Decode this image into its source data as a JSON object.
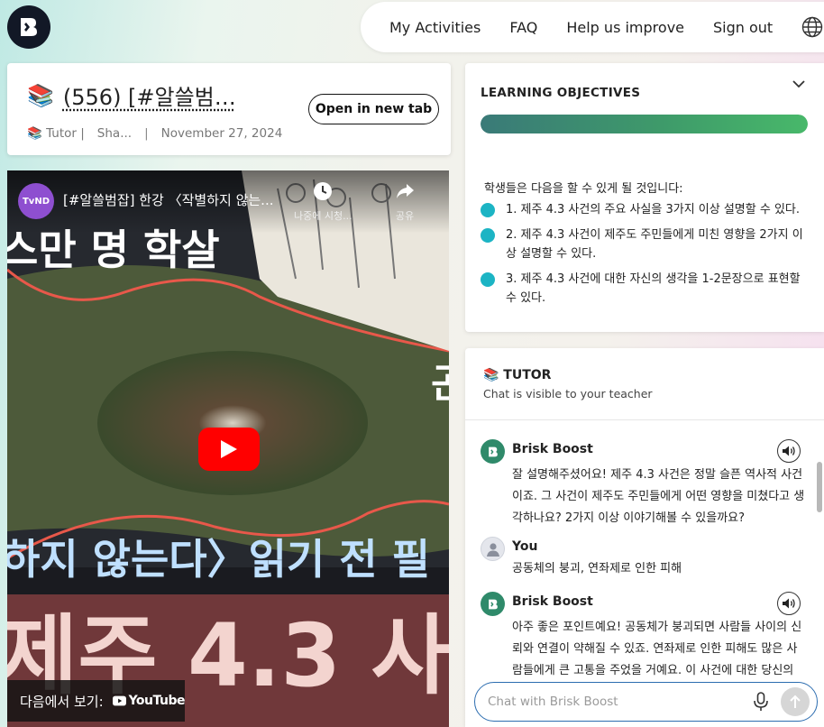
{
  "nav": {
    "links": [
      "My Activities",
      "FAQ",
      "Help us improve",
      "Sign out"
    ],
    "globe_icon": "globe-icon"
  },
  "activity": {
    "title": "(556) [#알쓸범…",
    "book_emoji": "📚",
    "meta": {
      "tutor": "📚 Tutor |",
      "shared": "Sha...",
      "divider": "|",
      "date": "November 27, 2024"
    },
    "open_button": "Open in new tab"
  },
  "video": {
    "channel_badge": "TvND",
    "title": "[#알쓸범잡] 한강 〈작별하지 않는...",
    "watch_later": "나중에 시청...",
    "share": "공유",
    "overlay_text_1": "스만 명 학살",
    "overlay_text_2": "하지 않는다〉읽기 전 필",
    "overlay_text_3": "제주 4.3 사",
    "overlay_text_4": "곤",
    "watch_on": "다음에서 보기:",
    "youtube_label": "YouTube"
  },
  "objectives": {
    "heading": "LEARNING OBJECTIVES",
    "progress": 1.0,
    "progress_color_start": "#3a7a78",
    "progress_color_end": "#48b86a",
    "intro": "학생들은 다음을 할 수 있게 될 것입니다:",
    "items": [
      "1. 제주 4.3 사건의 주요 사실을 3가지 이상 설명할 수 있다.",
      "2. 제주 4.3 사건이 제주도 주민들에게 미친 영향을 2가지 이상 설명할 수 있다.",
      "3. 제주 4.3 사건에 대한 자신의 생각을 1-2문장으로 표현할 수 있다."
    ],
    "bullet_color": "#1cb4c4"
  },
  "tutor": {
    "title": "📚 TUTOR",
    "subtitle": "Chat is visible to your teacher",
    "messages": [
      {
        "sender": "Brisk Boost",
        "text": "잘 설명해주셨어요! 제주 4.3 사건은 정말 슬픈 역사적 사건이죠. 그 사건이 제주도 주민들에게 어떤 영향을 미쳤다고 생각하나요? 2가지 이상 이야기해볼 수 있을까요?"
      },
      {
        "sender": "You",
        "text": "공동체의 붕괴, 연좌제로 인한 피해"
      },
      {
        "sender": "Brisk Boost",
        "text": "아주 좋은 포인트예요! 공동체가 붕괴되면 사람들 사이의 신뢰와 연결이 약해질 수 있죠. 연좌제로 인한 피해도 많은 사람들에게 큰 고통을 주었을 거예요. 이 사건에 대한 당신의"
      }
    ],
    "input_placeholder": "Chat with Brisk Boost",
    "bot_color": "#2f8a6a",
    "input_border_color": "#2c6db0"
  }
}
